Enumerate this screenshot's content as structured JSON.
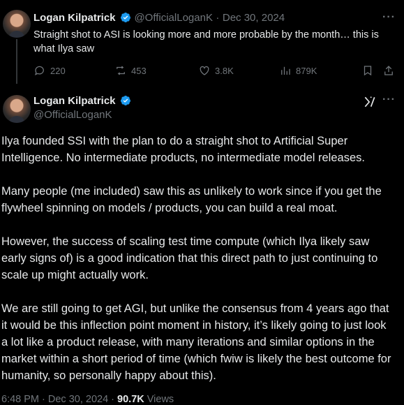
{
  "reply": {
    "author_name": "Logan Kilpatrick",
    "handle": "@OfficialLoganK",
    "separator": "·",
    "date": "Dec 30, 2024",
    "text": "Straight shot to ASI is looking more and more probable by the month… this is what Ilya saw",
    "replies": "220",
    "reposts": "453",
    "likes": "3.8K",
    "views": "879K"
  },
  "main": {
    "author_name": "Logan Kilpatrick",
    "handle": "@OfficialLoganK",
    "paragraphs": [
      "Ilya founded SSI with the plan to do a straight shot to Artificial Super Intelligence. No intermediate products, no intermediate model releases.",
      "Many people (me included) saw this as unlikely to work since if you get the flywheel spinning on models / products, you can build a real moat.",
      "However, the success of scaling test time compute (which Ilya likely saw early signs of) is a good indication that this direct path to just continuing to scale up might actually work.",
      "We are still going to get AGI, but unlike the consensus from 4 years ago that it would be this inflection point moment in history, it’s likely going to just look a lot like a product release, with many iterations and similar options in the market within a short period of time (which fwiw is likely the best outcome for humanity, so personally happy about this)."
    ],
    "time": "6:48 PM · Dec 30, 2024 · ",
    "views_count": "90.7K",
    "views_label": " Views"
  },
  "icons": {
    "verified": "verified-badge-icon",
    "more": "more-icon",
    "reply": "reply-icon",
    "repost": "repost-icon",
    "like": "heart-icon",
    "views": "views-chart-icon",
    "bookmark": "bookmark-icon",
    "grok": "grok-icon"
  },
  "colors": {
    "background": "#000000",
    "text": "#e7e9ea",
    "muted": "#71767b",
    "verified": "#1d9bf0"
  }
}
